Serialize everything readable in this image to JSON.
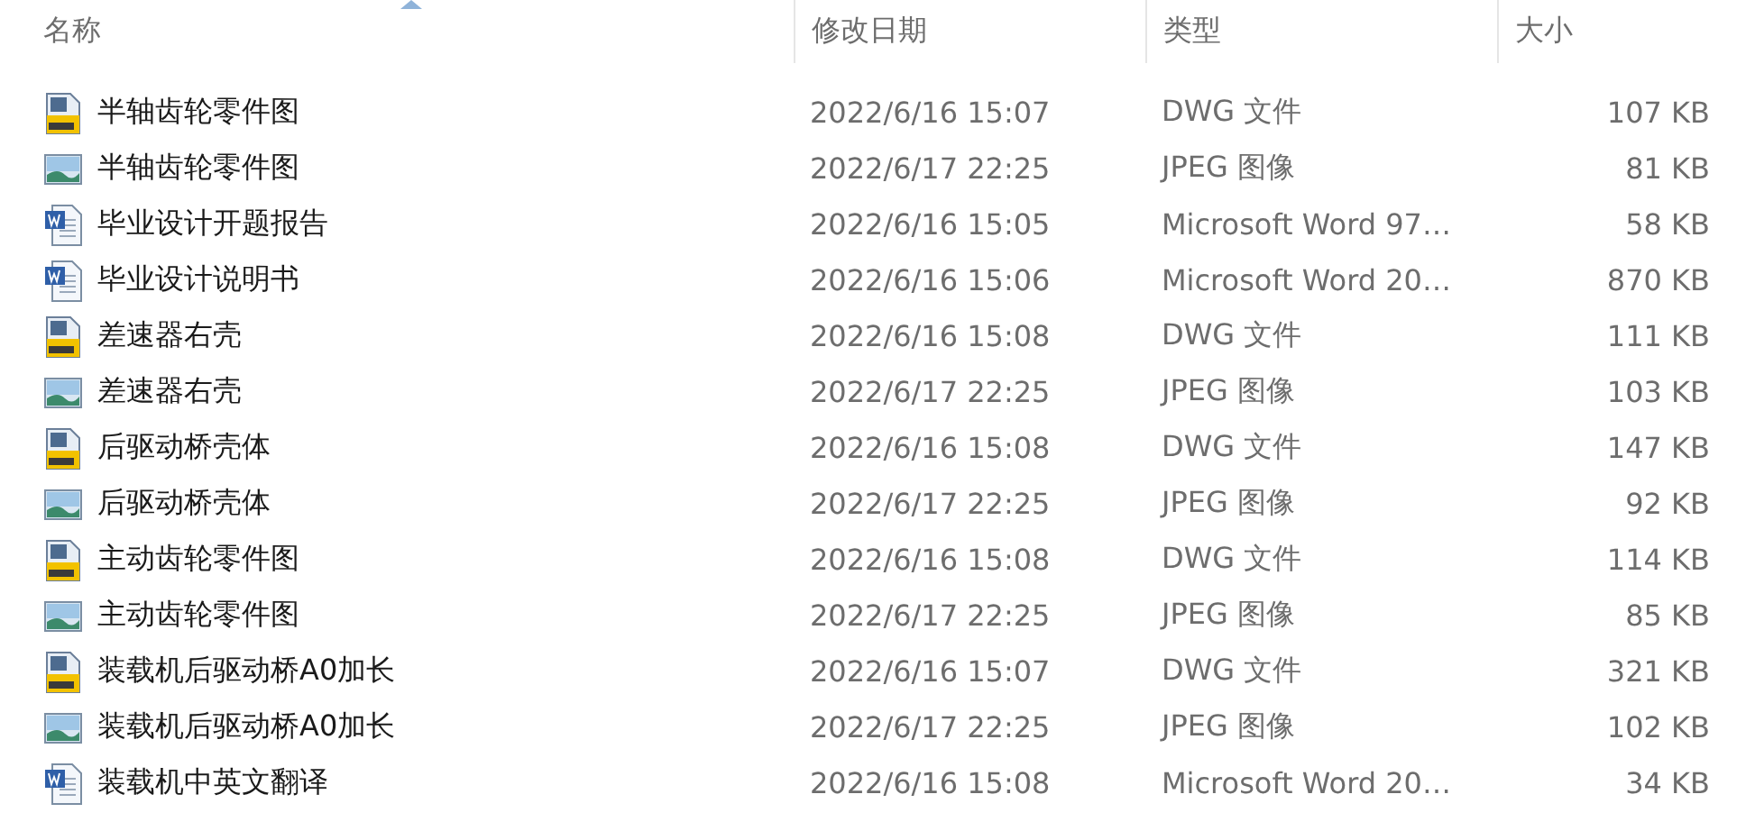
{
  "columns": [
    {
      "label": "名称",
      "sorted": true
    },
    {
      "label": "修改日期",
      "sorted": false
    },
    {
      "label": "类型",
      "sorted": false
    },
    {
      "label": "大小",
      "sorted": false
    }
  ],
  "files": [
    {
      "kind": "dwg",
      "name": "半轴齿轮零件图",
      "modified": "2022/6/16 15:07",
      "type": "DWG 文件",
      "size": "107 KB"
    },
    {
      "kind": "jpeg",
      "name": "半轴齿轮零件图",
      "modified": "2022/6/17 22:25",
      "type": "JPEG 图像",
      "size": "81 KB"
    },
    {
      "kind": "word",
      "name": "毕业设计开题报告",
      "modified": "2022/6/16 15:05",
      "type": "Microsoft Word 97…",
      "size": "58 KB"
    },
    {
      "kind": "word",
      "name": "毕业设计说明书",
      "modified": "2022/6/16 15:06",
      "type": "Microsoft Word 20…",
      "size": "870 KB"
    },
    {
      "kind": "dwg",
      "name": "差速器右壳",
      "modified": "2022/6/16 15:08",
      "type": "DWG 文件",
      "size": "111 KB"
    },
    {
      "kind": "jpeg",
      "name": "差速器右壳",
      "modified": "2022/6/17 22:25",
      "type": "JPEG 图像",
      "size": "103 KB"
    },
    {
      "kind": "dwg",
      "name": "后驱动桥壳体",
      "modified": "2022/6/16 15:08",
      "type": "DWG 文件",
      "size": "147 KB"
    },
    {
      "kind": "jpeg",
      "name": "后驱动桥壳体",
      "modified": "2022/6/17 22:25",
      "type": "JPEG 图像",
      "size": "92 KB"
    },
    {
      "kind": "dwg",
      "name": "主动齿轮零件图",
      "modified": "2022/6/16 15:08",
      "type": "DWG 文件",
      "size": "114 KB"
    },
    {
      "kind": "jpeg",
      "name": "主动齿轮零件图",
      "modified": "2022/6/17 22:25",
      "type": "JPEG 图像",
      "size": "85 KB"
    },
    {
      "kind": "dwg",
      "name": "装载机后驱动桥A0加长",
      "modified": "2022/6/16 15:07",
      "type": "DWG 文件",
      "size": "321 KB"
    },
    {
      "kind": "jpeg",
      "name": "装载机后驱动桥A0加长",
      "modified": "2022/6/17 22:25",
      "type": "JPEG 图像",
      "size": "102 KB"
    },
    {
      "kind": "word",
      "name": "装载机中英文翻译",
      "modified": "2022/6/16 15:08",
      "type": "Microsoft Word 20…",
      "size": "34 KB"
    }
  ]
}
